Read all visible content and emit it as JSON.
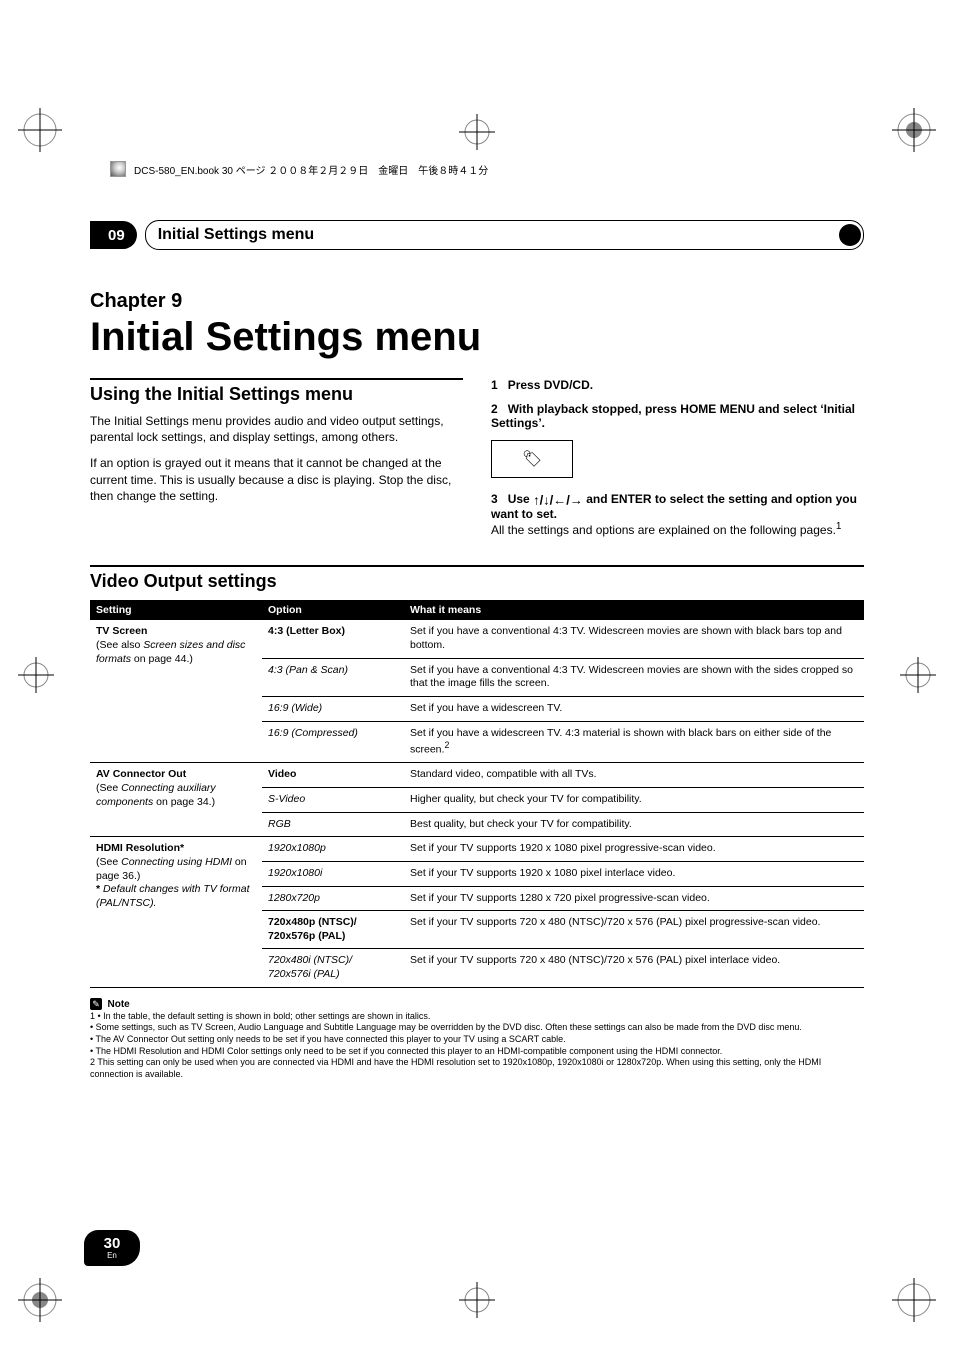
{
  "top_strip": "DCS-580_EN.book  30 ページ  ２００８年２月２９日　金曜日　午後８時４１分",
  "chapter_badge_num": "09",
  "chapter_bar_title": "Initial Settings menu",
  "chapter_label": "Chapter 9",
  "chapter_title": "Initial Settings menu",
  "section_using_title": "Using the Initial Settings menu",
  "section_using_p1": "The Initial Settings menu provides audio and video output settings, parental lock settings, and display settings, among others.",
  "section_using_p2": "If an option is grayed out it means that it cannot be changed at the current time. This is usually because a disc is playing. Stop the disc, then change the setting.",
  "step1_num": "1",
  "step1_text": "Press DVD/CD.",
  "step2_num": "2",
  "step2_text": "With playback stopped, press HOME MENU and select ‘Initial Settings’.",
  "icon_box_glyph": "⦿",
  "step3_num": "3",
  "step3_pre": "Use ",
  "step3_arrows": "↑/↓/←/→",
  "step3_post": " and ENTER to select the setting and option you want to set.",
  "step3_body": "All the settings and options are explained on the following pages.",
  "step3_sup": "1",
  "vo_title": "Video Output settings",
  "table": {
    "headers": [
      "Setting",
      "Option",
      "What it means"
    ],
    "rows": [
      {
        "setting_main": "TV Screen",
        "setting_sub1": "(See also ",
        "setting_sub1_ital": "Screen sizes and disc formats",
        "setting_sub1_post": " on page 44.)",
        "option_bold": "4:3 (Letter Box)",
        "option_ital": "",
        "desc": "Set if you have a conventional 4:3 TV. Widescreen movies are shown with black bars top and bottom."
      },
      {
        "setting_main": "",
        "option_ital": "4:3 (Pan & Scan)",
        "desc": "Set if you have a conventional 4:3 TV. Widescreen movies are shown with the sides cropped so that the image fills the screen."
      },
      {
        "setting_main": "",
        "option_ital": "16:9 (Wide)",
        "desc": "Set if you have a widescreen TV."
      },
      {
        "setting_main": "",
        "option_ital": "16:9 (Compressed)",
        "desc": "Set if you have a widescreen TV. 4:3 material is shown with black bars on either side of the screen.",
        "desc_sup": "2"
      },
      {
        "setting_main": "AV Connector Out",
        "setting_sub1": "(See ",
        "setting_sub1_ital": "Connecting auxiliary components",
        "setting_sub1_post": " on page 34.)",
        "option_bold": "Video",
        "desc": "Standard video, compatible with all TVs."
      },
      {
        "setting_main": "",
        "option_ital": "S-Video",
        "desc": "Higher quality, but check your TV for compatibility."
      },
      {
        "setting_main": "",
        "option_ital": "RGB",
        "desc": "Best quality, but check your TV for compatibility."
      },
      {
        "setting_main": "HDMI Resolution*",
        "setting_sub1": "(See ",
        "setting_sub1_ital": "Connecting using HDMI",
        "setting_sub1_post": " on page 36.)",
        "setting_sub2_pre": "* ",
        "setting_sub2_ital": "Default changes with TV format (PAL/NTSC).",
        "option_ital": "1920x1080p",
        "desc": "Set if your TV supports 1920 x 1080 pixel progressive-scan video."
      },
      {
        "setting_main": "",
        "option_ital": "1920x1080i",
        "desc": "Set if your TV supports 1920 x 1080 pixel interlace video."
      },
      {
        "setting_main": "",
        "option_ital": "1280x720p",
        "desc": "Set if your TV supports 1280 x 720 pixel progressive-scan video."
      },
      {
        "setting_main": "",
        "option_bold": "720x480p (NTSC)/\n720x576p (PAL)",
        "desc": "Set if your TV supports 720 x 480 (NTSC)/720 x 576 (PAL) pixel progressive-scan video."
      },
      {
        "setting_main": "",
        "option_ital": "720x480i (NTSC)/\n720x576i (PAL)",
        "desc": "Set if your TV supports 720 x 480 (NTSC)/720 x 576 (PAL) pixel interlace video."
      }
    ]
  },
  "note_label": "Note",
  "note_lines": [
    "1 • In the table, the default setting is shown in bold; other settings are shown in italics.",
    "   • Some settings, such as TV Screen, Audio Language and Subtitle Language may be overridden by the DVD disc. Often these settings can also be made from the DVD disc menu.",
    "   • The AV Connector Out setting only needs to be set if you have connected this player to your TV using a SCART cable.",
    "   • The HDMI Resolution and HDMI Color settings only need to be set if you connected this player to an HDMI-compatible component using the HDMI connector.",
    "2  This setting can only be used when you are connected via HDMI and have the HDMI resolution set to 1920x1080p, 1920x1080i or 1280x720p. When using this setting, only the HDMI connection is available."
  ],
  "page_number": "30",
  "page_lang": "En"
}
